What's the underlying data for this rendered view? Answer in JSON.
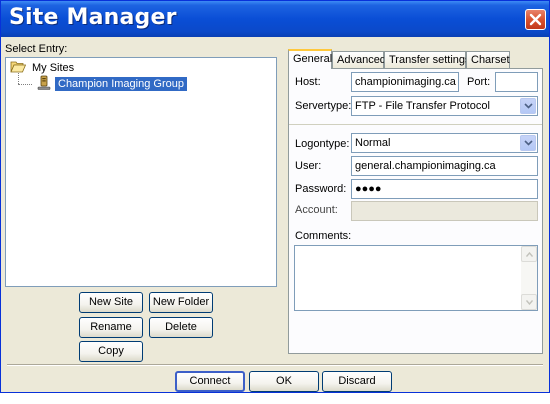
{
  "window": {
    "title": "Site Manager"
  },
  "tree": {
    "label": "Select Entry:",
    "root": "My Sites",
    "site": "Champion Imaging Group"
  },
  "left_buttons": {
    "new_site": "New Site",
    "new_folder": "New Folder",
    "rename": "Rename",
    "delete": "Delete",
    "copy": "Copy"
  },
  "tabs": [
    {
      "label": "General",
      "active": true
    },
    {
      "label": "Advanced",
      "active": false
    },
    {
      "label": "Transfer settings",
      "active": false
    },
    {
      "label": "Charset",
      "active": false
    }
  ],
  "general": {
    "host_label": "Host:",
    "host_value": "championimaging.ca",
    "port_label": "Port:",
    "port_value": "",
    "servertype_label": "Servertype:",
    "servertype_value": "FTP - File Transfer Protocol",
    "logontype_label": "Logontype:",
    "logontype_value": "Normal",
    "user_label": "User:",
    "user_value": "general.championimaging.ca",
    "password_label": "Password:",
    "password_value": "●●●●",
    "account_label": "Account:",
    "account_value": "",
    "comments_label": "Comments:",
    "comments_value": ""
  },
  "footer": {
    "connect": "Connect",
    "ok": "OK",
    "discard": "Discard"
  },
  "icons": {
    "close": "close-icon",
    "folder": "folder-open-icon",
    "site": "server-icon",
    "dropdown": "chevron-down-icon"
  },
  "colors": {
    "titlebar": "#0a4ed6",
    "selection": "#316ac5",
    "window_bg": "#ece9d8",
    "close": "#d9532f"
  }
}
